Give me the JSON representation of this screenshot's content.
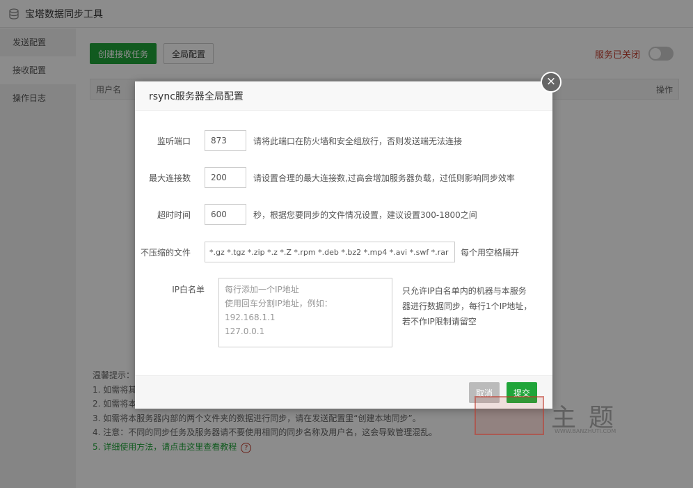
{
  "app": {
    "title": "宝塔数据同步工具",
    "sidebar": [
      {
        "label": "发送配置"
      },
      {
        "label": "接收配置"
      },
      {
        "label": "操作日志"
      }
    ],
    "toolbar": {
      "create_label": "创建接收任务",
      "global_label": "全局配置"
    },
    "service": {
      "status_text": "服务已关闭",
      "enabled": false
    },
    "table": {
      "col_user": "用户名",
      "col_action": "操作"
    },
    "tips": {
      "title": "温馨提示：",
      "items": [
        "1. 如需将其",
        "2. 如需将本",
        "3. 如需将本服务器内部的两个文件夹的数据进行同步，请在发送配置里“创建本地同步”。",
        "4. 注意：不同的同步任务及服务器请不要使用相同的同步名称及用户名，这会导致管理混乱。"
      ],
      "link_prefix": "5. ",
      "link_text": "详细使用方法，请点击这里查看教程",
      "help_icon": "?"
    }
  },
  "modal": {
    "title": "rsync服务器全局配置",
    "close_icon": "×",
    "fields": {
      "port": {
        "label": "监听端口",
        "value": "873",
        "hint": "请将此端口在防火墙和安全组放行，否则发送端无法连接"
      },
      "max_conn": {
        "label": "最大连接数",
        "value": "200",
        "hint": "请设置合理的最大连接数,过高会增加服务器负载，过低则影响同步效率"
      },
      "timeout": {
        "label": "超时时间",
        "value": "600",
        "hint": "秒，根据您要同步的文件情况设置，建议设置300-1800之间"
      },
      "no_compress": {
        "label": "不压缩的文件",
        "value": "*.gz *.tgz *.zip *.z *.Z *.rpm *.deb *.bz2 *.mp4 *.avi *.swf *.rar",
        "hint": "每个用空格隔开"
      },
      "ip_whitelist": {
        "label": "IP白名单",
        "placeholder_lines": [
          "每行添加一个IP地址",
          "使用回车分割IP地址，例如：",
          "192.168.1.1",
          "127.0.0.1"
        ],
        "note": "只允许IP白名单内的机器与本服务器进行数据同步，每行1个IP地址，若不作IP限制请留空"
      }
    },
    "buttons": {
      "cancel": "取消",
      "submit": "提交"
    }
  },
  "watermark": {
    "text": "主题",
    "url": "WWW.BANZHUTI.COM"
  }
}
